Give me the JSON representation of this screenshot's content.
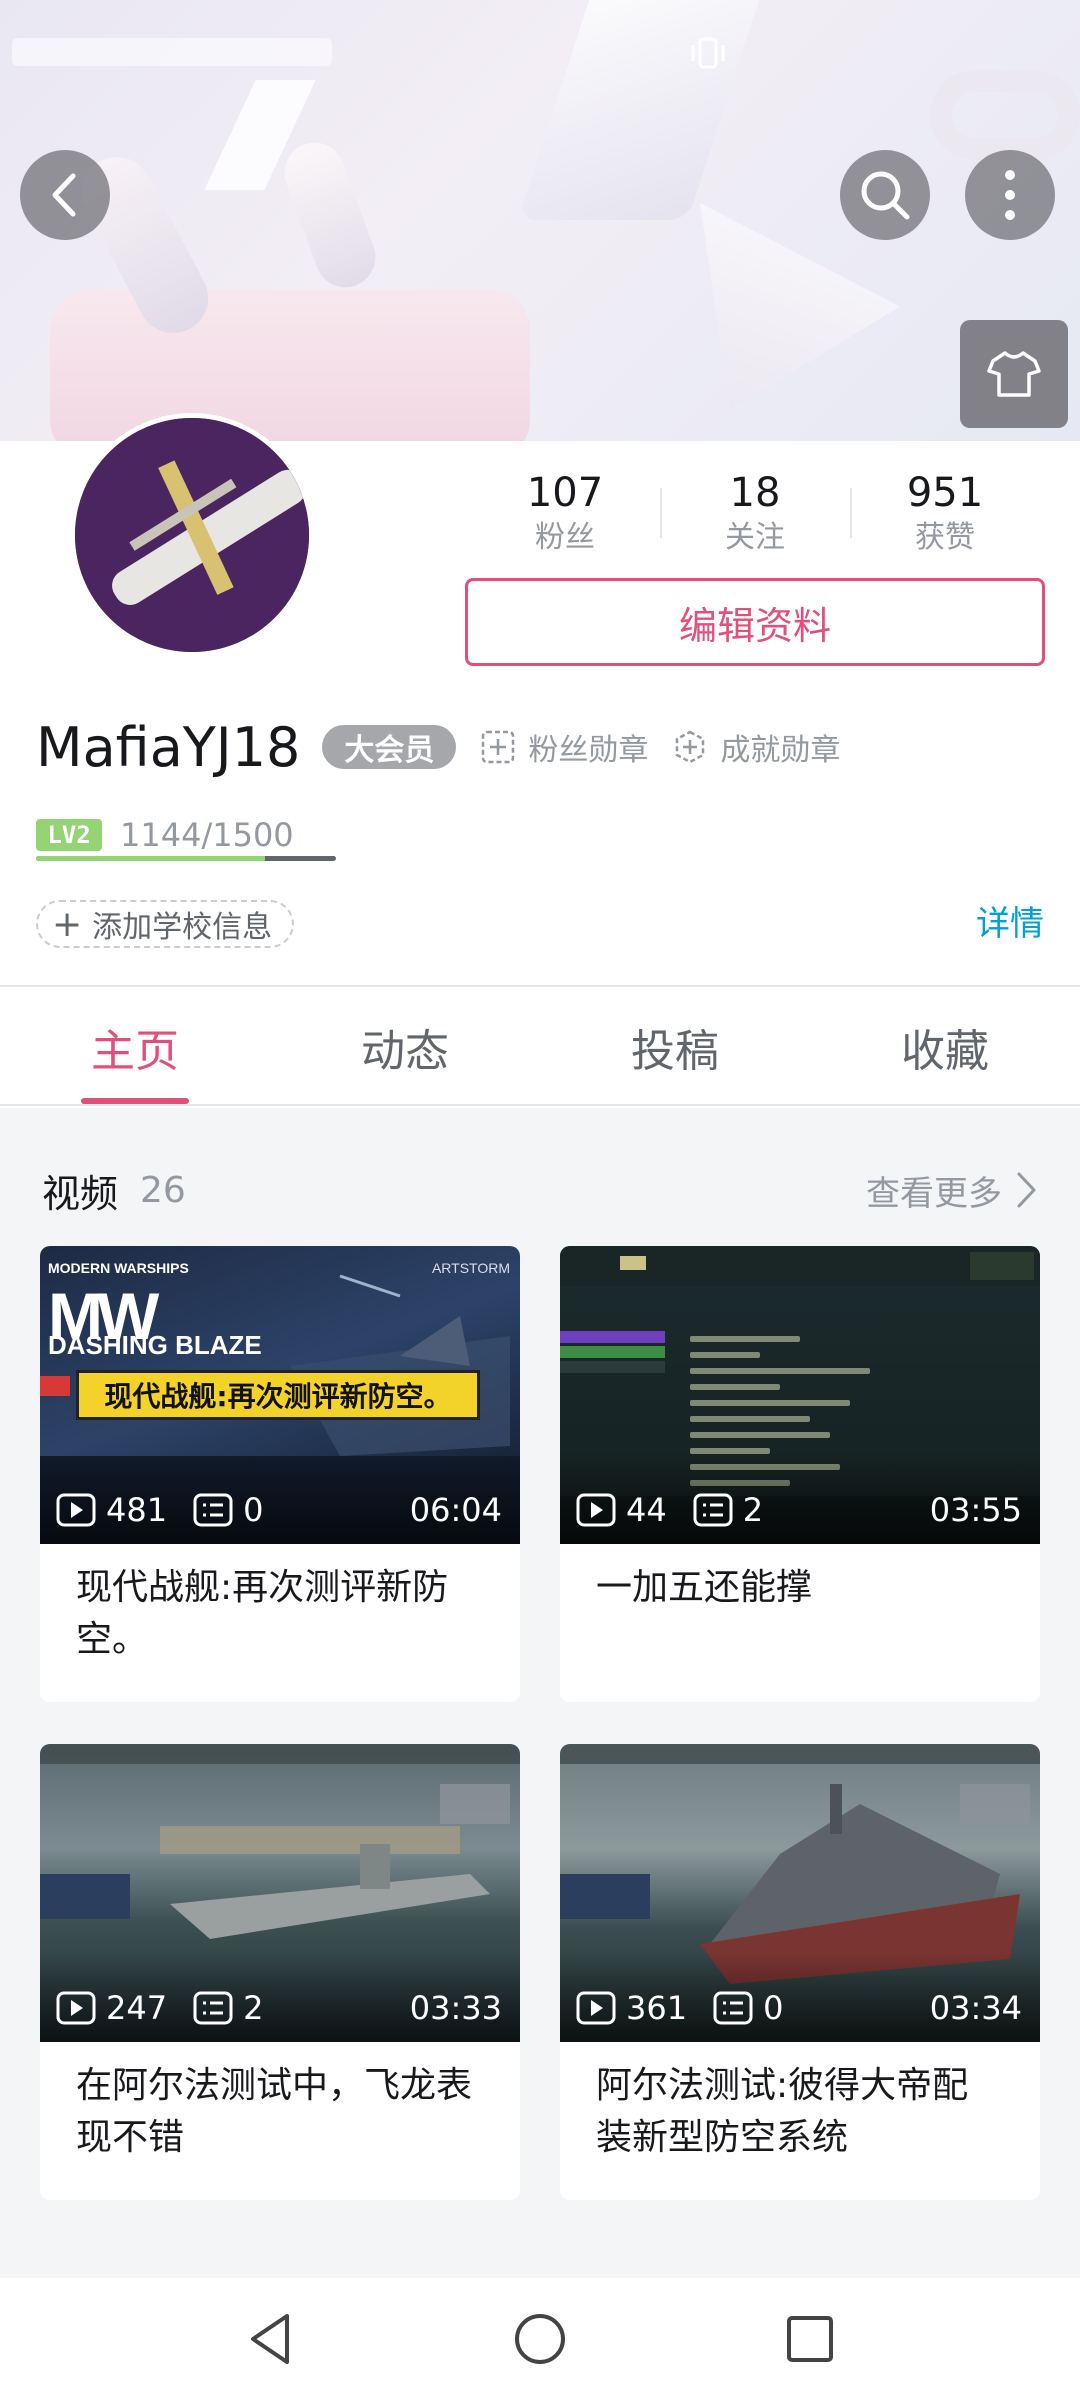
{
  "profile": {
    "stats": [
      {
        "value": "107",
        "label": "粉丝"
      },
      {
        "value": "18",
        "label": "关注"
      },
      {
        "value": "951",
        "label": "获赞"
      }
    ],
    "edit_label": "编辑资料",
    "username": "MafiaYJ18",
    "vip_label": "大会员",
    "fan_medal_label": "粉丝勋章",
    "achievement_medal_label": "成就勋章",
    "level_badge": "LV2",
    "exp_text": "1144/1500",
    "exp_fraction": 0.763,
    "add_school_label": "添加学校信息",
    "detail_label": "详情"
  },
  "tabs": [
    {
      "label": "主页",
      "active": true
    },
    {
      "label": "动态",
      "active": false
    },
    {
      "label": "投稿",
      "active": false
    },
    {
      "label": "收藏",
      "active": false
    }
  ],
  "videos_section": {
    "title": "视频",
    "count": "26",
    "see_more_label": "查看更多",
    "items": [
      {
        "title": "现代战舰:再次测评新防空。",
        "plays": "481",
        "comments": "0",
        "duration": "06:04",
        "thumb_brand": "MODERN WARSHIPS",
        "thumb_logo": "MW",
        "thumb_sub": "DASHING BLAZE",
        "thumb_partner": "ARTSTORM",
        "thumb_banner": "现代战舰:再次测评新防空。"
      },
      {
        "title": "一加五还能撑",
        "plays": "44",
        "comments": "2",
        "duration": "03:55"
      },
      {
        "title": "在阿尔法测试中，飞龙表现不错",
        "plays": "247",
        "comments": "2",
        "duration": "03:33"
      },
      {
        "title": "阿尔法测试:彼得大帝配装新型防空系统",
        "plays": "361",
        "comments": "0",
        "duration": "03:34"
      }
    ]
  },
  "colors": {
    "accent": "#e0507b",
    "link": "#00a1d6",
    "level_green": "#95d475"
  },
  "icons": [
    "back-arrow-icon",
    "search-icon",
    "more-vertical-icon",
    "tshirt-icon",
    "vibrate-icon",
    "medal-plus-icon",
    "plus-icon",
    "chevron-right-icon",
    "play-icon",
    "comment-icon",
    "nav-back-icon",
    "nav-home-icon",
    "nav-recents-icon"
  ]
}
